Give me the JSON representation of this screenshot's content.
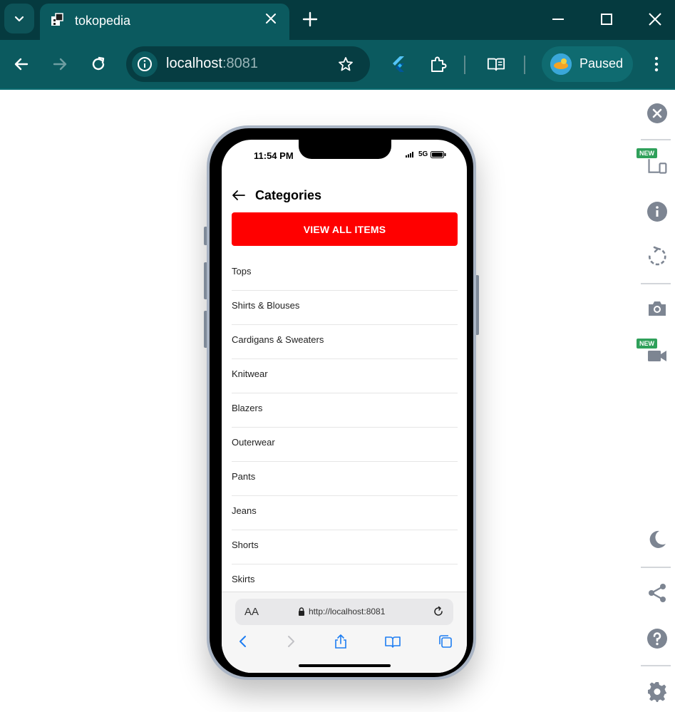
{
  "tab": {
    "title": "tokopedia"
  },
  "omnibox": {
    "host": "localhost",
    "port": ":8081"
  },
  "profile": {
    "label": "Paused"
  },
  "side_panel": {
    "new_badge": "NEW"
  },
  "phone": {
    "time": "11:54 PM",
    "network": "5G",
    "header": {
      "title": "Categories"
    },
    "view_all_label": "VIEW ALL ITEMS",
    "categories": [
      "Tops",
      "Shirts & Blouses",
      "Cardigans & Sweaters",
      "Knitwear",
      "Blazers",
      "Outerwear",
      "Pants",
      "Jeans",
      "Shorts",
      "Skirts"
    ],
    "safari": {
      "aa": "AA",
      "url": "http://localhost:8081"
    }
  },
  "colors": {
    "toolbar": "#0b5a5f",
    "tabstrip": "#053a3f",
    "accent_red": "#ff0000",
    "safari_blue": "#1d7df2"
  }
}
